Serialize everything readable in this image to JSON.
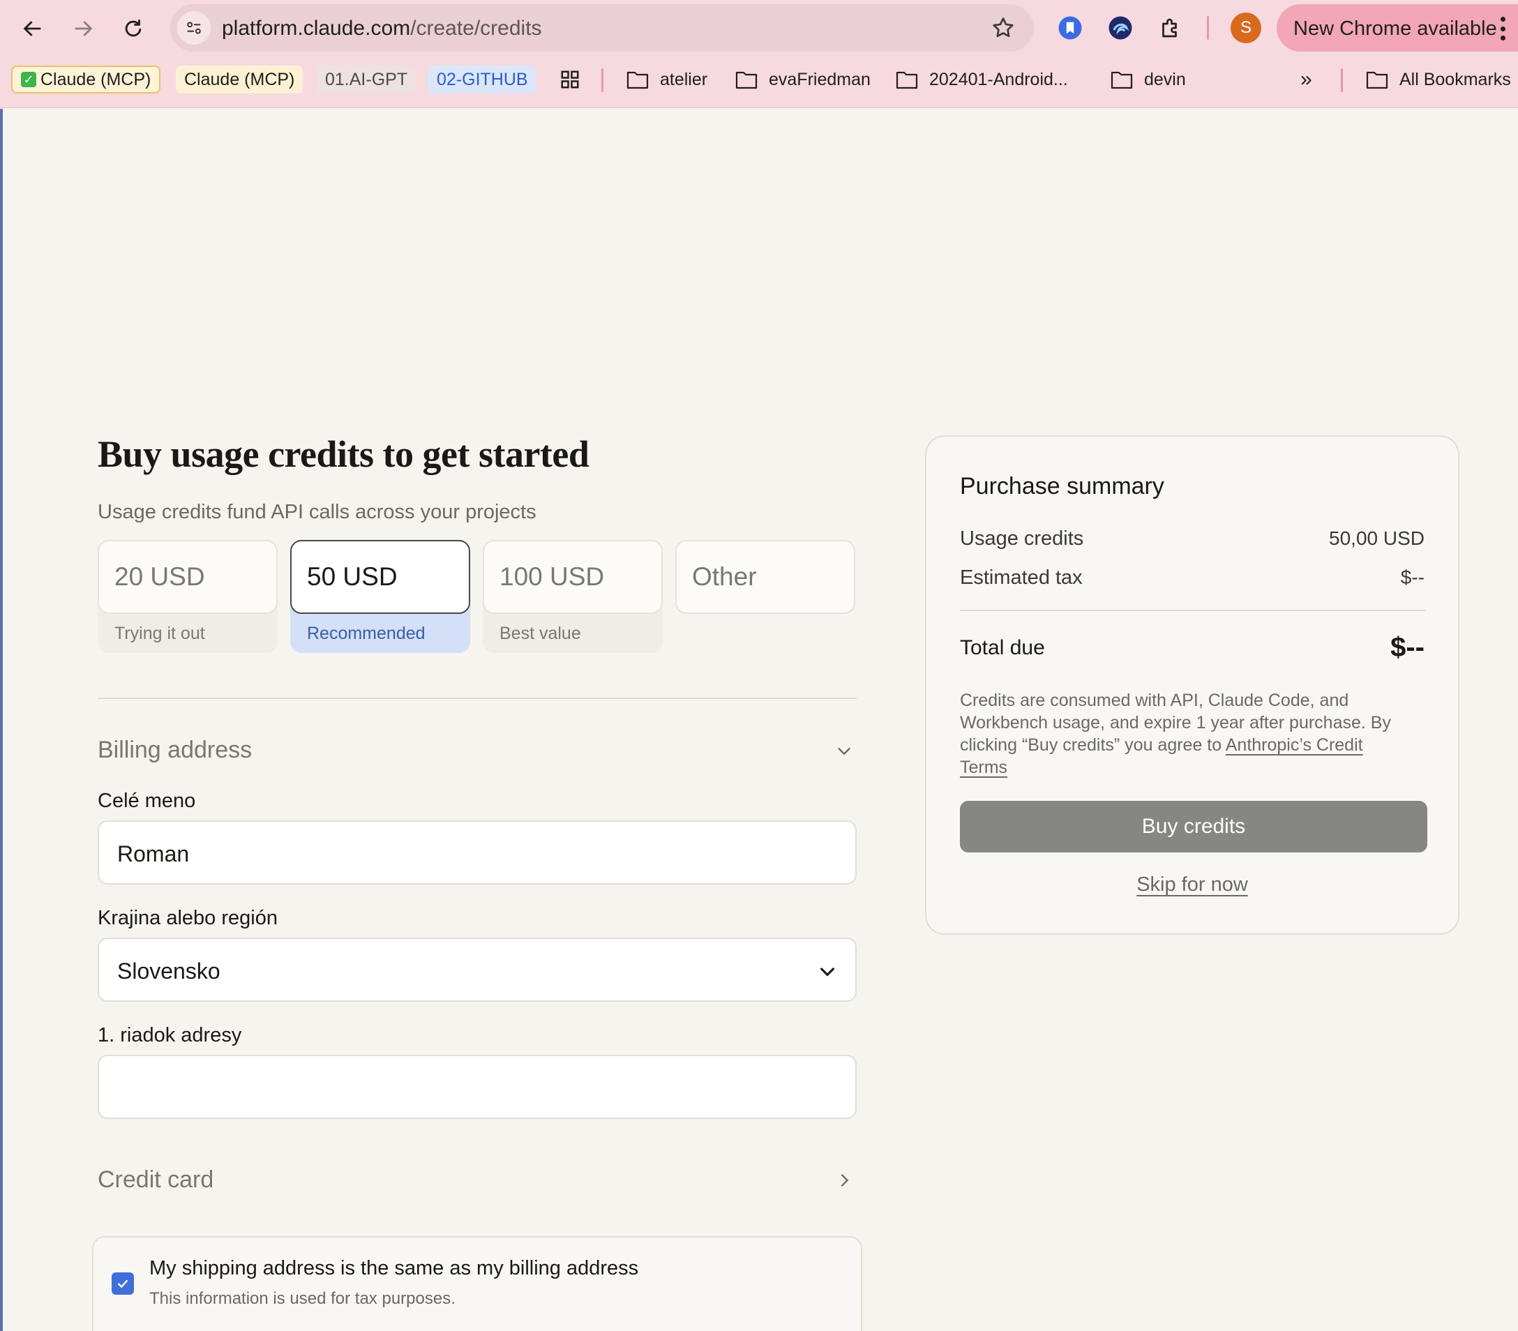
{
  "browser": {
    "url_host": "platform.claude.com",
    "url_path": "/create/credits",
    "avatar_letter": "S",
    "update_label": "New Chrome available",
    "bookmarks": {
      "chip1": "Claude (MCP)",
      "chip2": "Claude (MCP)",
      "chip3": "01.AI-GPT",
      "chip4": "02-GITHUB",
      "folder1": "atelier",
      "folder2": "evaFriedman",
      "folder3": "202401-Android...",
      "folder4": "devin",
      "all": "All Bookmarks"
    }
  },
  "page": {
    "title": "Buy usage credits to get started",
    "subtitle": "Usage credits fund API calls across your projects",
    "amounts": [
      {
        "value": "20 USD",
        "tag": "Trying it out",
        "selected": false
      },
      {
        "value": "50 USD",
        "tag": "Recommended",
        "selected": true
      },
      {
        "value": "100 USD",
        "tag": "Best value",
        "selected": false
      },
      {
        "value": "Other",
        "tag": "",
        "selected": false
      }
    ],
    "billing": {
      "title": "Billing address",
      "name_label": "Celé meno",
      "name_value": "Roman",
      "country_label": "Krajina alebo región",
      "country_value": "Slovensko",
      "address1_label": "1. riadok adresy",
      "address1_value": ""
    },
    "credit_card_title": "Credit card",
    "shipping": {
      "checked": true,
      "title": "My shipping address is the same as my billing address",
      "subtitle": "This information is used for tax purposes."
    }
  },
  "summary": {
    "title": "Purchase summary",
    "usage_label": "Usage credits",
    "usage_value": "50,00 USD",
    "tax_label": "Estimated tax",
    "tax_value": "$--",
    "total_label": "Total due",
    "total_value": "$--",
    "legal_text": "Credits are consumed with API, Claude Code, and Workbench usage, and expire 1 year after purchase. By clicking “Buy credits” you agree to ",
    "legal_link": "Anthropic’s Credit Terms",
    "buy_label": "Buy credits",
    "skip_label": "Skip for now"
  },
  "colors": {
    "chrome_bg": "#f7d9e0",
    "accent_blue": "#3f6fd8",
    "recommended_bg": "#d3e0f7",
    "button_gray": "#868683"
  }
}
